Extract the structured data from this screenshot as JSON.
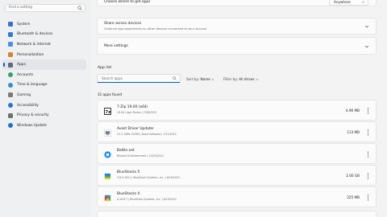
{
  "sidebar": {
    "search_placeholder": "Find a setting",
    "items": [
      {
        "label": "System",
        "icon": "system-icon",
        "color": "#3a6fd8"
      },
      {
        "label": "Bluetooth & devices",
        "icon": "bluetooth-icon",
        "color": "#2c7de0"
      },
      {
        "label": "Network & internet",
        "icon": "network-icon",
        "color": "#4a8fe0"
      },
      {
        "label": "Personalization",
        "icon": "personalization-icon",
        "color": "#d9842b"
      },
      {
        "label": "Apps",
        "icon": "apps-icon",
        "color": "#5b6b7d"
      },
      {
        "label": "Accounts",
        "icon": "accounts-icon",
        "color": "#2fa46a"
      },
      {
        "label": "Time & language",
        "icon": "time-language-icon",
        "color": "#2b8fd6"
      },
      {
        "label": "Gaming",
        "icon": "gaming-icon",
        "color": "#7a7a7a"
      },
      {
        "label": "Accessibility",
        "icon": "accessibility-icon",
        "color": "#1f78d1"
      },
      {
        "label": "Privacy & security",
        "icon": "privacy-icon",
        "color": "#6b6f76"
      },
      {
        "label": "Windows Update",
        "icon": "windows-update-icon",
        "color": "#1a73d0"
      }
    ],
    "active_index": 4
  },
  "main": {
    "choose_where": {
      "label": "Choose where to get apps",
      "value": "Anywhere"
    },
    "share_devices": {
      "title": "Share across devices",
      "subtitle": "Continue app experiences on other devices connected to your account"
    },
    "more_settings": {
      "label": "More settings"
    },
    "app_list": {
      "heading": "App list",
      "search_placeholder": "Search apps",
      "sort_label": "Sort by:",
      "sort_value": "Name",
      "filter_label": "Filter by:",
      "filter_value": "All drives",
      "count_text": "31 apps found",
      "apps": [
        {
          "name": "7-Zip 19.00 (x64)",
          "meta": "19.00  |  Igor Pavlov  |  7/28/2022",
          "size": "4.96 MB",
          "icon": "sevenzip-icon"
        },
        {
          "name": "Avast Driver Updater",
          "meta": "22.2.1466.15286  |  Avast Software  |  7/21/2022",
          "size": "113 MB",
          "icon": "avast-driver-updater-icon"
        },
        {
          "name": "Battle.net",
          "meta": "Blizzard Entertainment  |  10/23/2021",
          "size": "",
          "icon": "battlenet-icon"
        },
        {
          "name": "BlueStacks 5",
          "meta": "5.8.0.1051  |  BlueStack Systems, Inc.  |  8/19/2022",
          "size": "2.00 GB",
          "icon": "bluestacks5-icon"
        },
        {
          "name": "BlueStacks X",
          "meta": "0.16.8.7  |  BlueStack Systems, Inc.  |  8/19/2022",
          "size": "225 MB",
          "icon": "bluestacksx-icon"
        }
      ]
    }
  }
}
